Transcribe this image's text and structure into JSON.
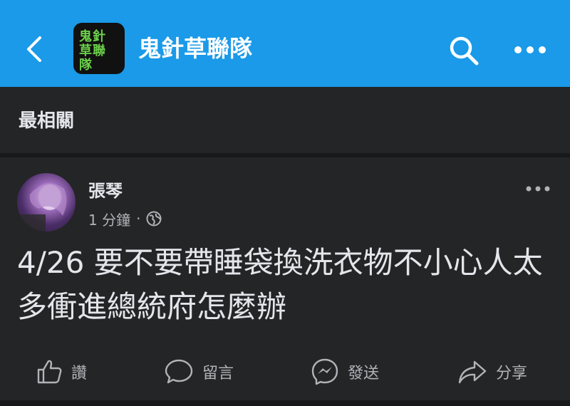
{
  "header": {
    "group_name": "鬼針草聯隊",
    "avatar_text": "鬼針\n草聯隊",
    "accent_color": "#1a9ae8"
  },
  "section": {
    "title": "最相關"
  },
  "post": {
    "author": "張琴",
    "time": "1 分鐘",
    "separator": "·",
    "privacy_icon": "globe-icon",
    "text": "4/26 要不要帶睡袋換洗衣物不小心人太多衝進總統府怎麼辦"
  },
  "actions": {
    "like": "讚",
    "comment": "留言",
    "send": "發送",
    "share": "分享"
  }
}
